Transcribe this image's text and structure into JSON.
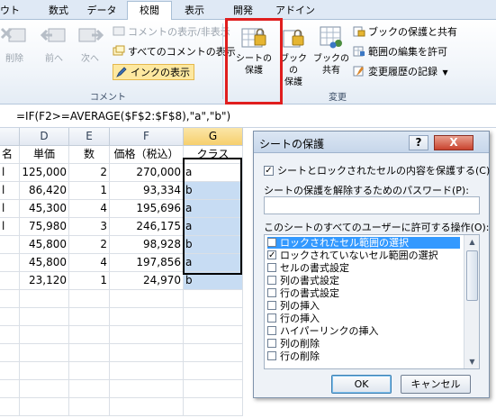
{
  "ribbon": {
    "tabs": [
      {
        "label": "ウト",
        "active": false
      },
      {
        "label": "数式",
        "active": false
      },
      {
        "label": "データ",
        "active": false
      },
      {
        "label": "校閲",
        "active": true
      },
      {
        "label": "表示",
        "active": false
      },
      {
        "label": "開発",
        "active": false
      },
      {
        "label": "アドイン",
        "active": false
      }
    ],
    "comment_group": {
      "label": "コメント",
      "delete_label": "削除",
      "prev_label": "前へ",
      "next_label": "次へ",
      "toggle_comment_label": "コメントの表示/非表示",
      "show_all_label": "すべてのコメントの表示",
      "show_ink_label": "インクの表示"
    },
    "changes_group": {
      "label": "変更",
      "protect_sheet_label": [
        "シートの",
        "保護"
      ],
      "protect_book_label": [
        "ブックの",
        "保護"
      ],
      "share_book_label": [
        "ブックの",
        "共有"
      ],
      "protect_share_label": "ブックの保護と共有",
      "allow_ranges_label": "範囲の編集を許可",
      "track_changes_label": "変更履歴の記録"
    }
  },
  "formula_bar": {
    "formula": "=IF(F2>=AVERAGE($F$2:$F$8),\"a\",\"b\")"
  },
  "sheet": {
    "column_headers": [
      "",
      "D",
      "E",
      "F",
      "G"
    ],
    "header_row": [
      "名",
      "単価",
      "数",
      "価格（税込）",
      "クラス"
    ],
    "rows": [
      [
        "l",
        "125,000",
        "2",
        "270,000",
        "a"
      ],
      [
        "l",
        "86,420",
        "1",
        "93,334",
        "b"
      ],
      [
        "l",
        "45,300",
        "4",
        "195,696",
        "a"
      ],
      [
        "l",
        "75,980",
        "3",
        "246,175",
        "a"
      ],
      [
        "",
        "45,800",
        "2",
        "98,928",
        "b"
      ],
      [
        "",
        "45,800",
        "4",
        "197,856",
        "a"
      ],
      [
        "",
        "23,120",
        "1",
        "24,970",
        "b"
      ]
    ]
  },
  "dialog": {
    "title": "シートの保護",
    "help_label": "?",
    "close_label": "X",
    "protect_checkbox_label": "シートとロックされたセルの内容を保護する(C)",
    "protect_checked": true,
    "password_label": "シートの保護を解除するためのパスワード(P):",
    "password_value": "",
    "permissions_label": "このシートのすべてのユーザーに許可する操作(O):",
    "permissions": [
      {
        "label": "ロックされたセル範囲の選択",
        "checked": true,
        "selected": true
      },
      {
        "label": "ロックされていないセル範囲の選択",
        "checked": true,
        "selected": false
      },
      {
        "label": "セルの書式設定",
        "checked": false,
        "selected": false
      },
      {
        "label": "列の書式設定",
        "checked": false,
        "selected": false
      },
      {
        "label": "行の書式設定",
        "checked": false,
        "selected": false
      },
      {
        "label": "列の挿入",
        "checked": false,
        "selected": false
      },
      {
        "label": "行の挿入",
        "checked": false,
        "selected": false
      },
      {
        "label": "ハイパーリンクの挿入",
        "checked": false,
        "selected": false
      },
      {
        "label": "列の削除",
        "checked": false,
        "selected": false
      },
      {
        "label": "行の削除",
        "checked": false,
        "selected": false
      }
    ],
    "ok_label": "OK",
    "cancel_label": "キャンセル"
  },
  "colors": {
    "highlight_red": "#e01e1e",
    "selected_cell_blue": "#c7dcf3",
    "list_selection": "#3399ff"
  }
}
